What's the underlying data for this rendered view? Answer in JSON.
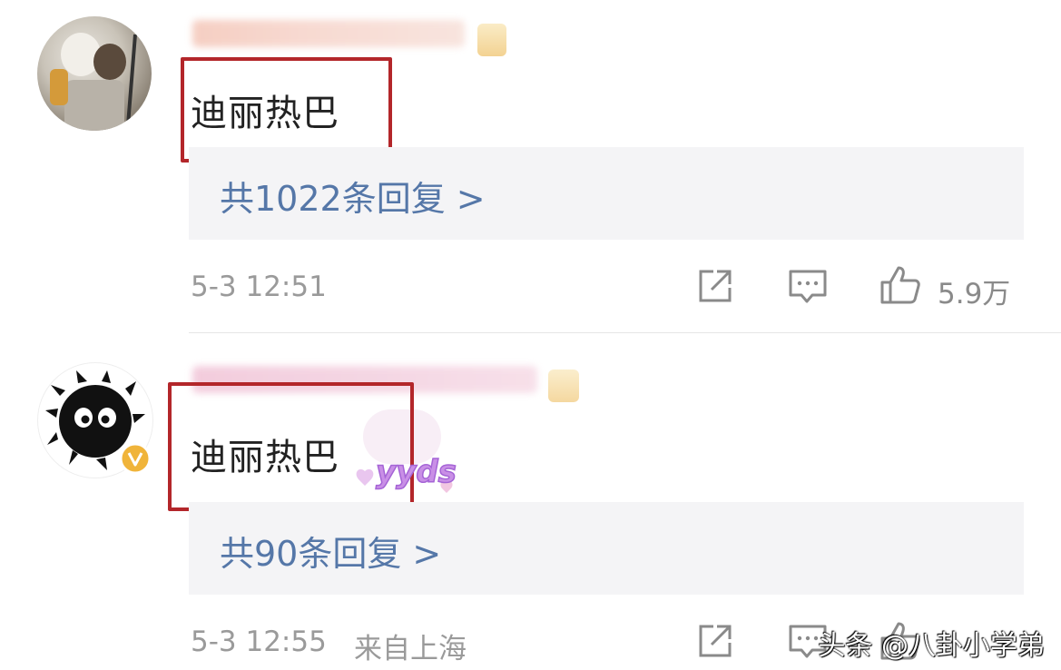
{
  "comments": [
    {
      "content": "迪丽热巴",
      "replies_label": "共1022条回复 >",
      "timestamp": "5-3 12:51",
      "likes": "5.9万"
    },
    {
      "content": "迪丽热巴",
      "sticker_text": "yyds",
      "replies_label": "共90条回复 >",
      "timestamp": "5-3 12:55",
      "location": "来自上海"
    }
  ],
  "watermark": "头条 @八卦小学弟",
  "colors": {
    "highlight": "#b3262a",
    "reply_link": "#5577a8",
    "verified_badge": "#f0b43a",
    "meta_text": "#9a9a9a"
  },
  "icons": [
    "share-icon",
    "comment-icon",
    "like-icon",
    "verified-icon"
  ]
}
